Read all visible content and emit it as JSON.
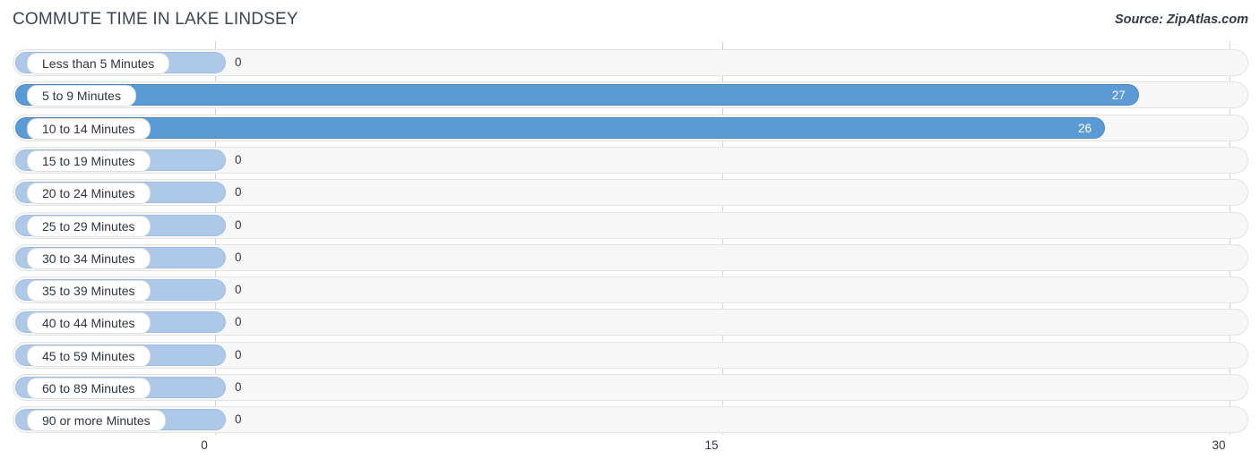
{
  "header": {
    "title": "COMMUTE TIME IN LAKE LINDSEY",
    "source": "Source: ZipAtlas.com"
  },
  "colors": {
    "bar_filled": "#5b9bd5",
    "bar_zero": "#aec9e8",
    "track": "#f7f7f7",
    "gridline": "#d2d2d2",
    "title_text": "#3c4552",
    "value_text_inside": "#ffffff",
    "value_text_outside": "#31373f"
  },
  "chart_data": {
    "type": "bar",
    "orientation": "horizontal",
    "title": "COMMUTE TIME IN LAKE LINDSEY",
    "subtitle": "",
    "xlabel": "",
    "ylabel": "",
    "xlim": [
      0,
      30
    ],
    "grid": true,
    "legend": null,
    "x_ticks": [
      "0",
      "15",
      "30"
    ],
    "x_tick_values": [
      0,
      15,
      30
    ],
    "categories": [
      "Less than 5 Minutes",
      "5 to 9 Minutes",
      "10 to 14 Minutes",
      "15 to 19 Minutes",
      "20 to 24 Minutes",
      "25 to 29 Minutes",
      "30 to 34 Minutes",
      "35 to 39 Minutes",
      "40 to 44 Minutes",
      "45 to 59 Minutes",
      "60 to 89 Minutes",
      "90 or more Minutes"
    ],
    "values": [
      0,
      27,
      26,
      0,
      0,
      0,
      0,
      0,
      0,
      0,
      0,
      0
    ],
    "value_labels": [
      "0",
      "27",
      "26",
      "0",
      "0",
      "0",
      "0",
      "0",
      "0",
      "0",
      "0",
      "0"
    ]
  }
}
